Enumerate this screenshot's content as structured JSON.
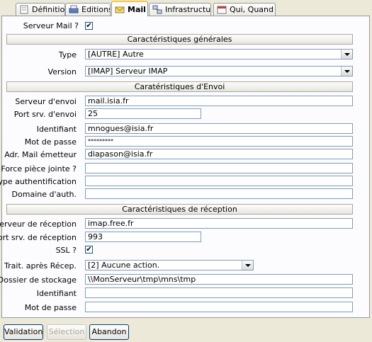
{
  "tabs": [
    {
      "label": "Définition",
      "icon": "document-icon"
    },
    {
      "label": "Editions",
      "icon": "printer-icon"
    },
    {
      "label": "Mail",
      "icon": "mail-icon",
      "active": true
    },
    {
      "label": "Infrastructure",
      "icon": "network-icon"
    },
    {
      "label": "Qui, Quand ?",
      "icon": "calendar-icon"
    }
  ],
  "serveur_mail": {
    "label": "Serveur Mail ?",
    "checked": true,
    "mark": "✔"
  },
  "general": {
    "title": "Caractéristiques générales",
    "type_label": "Type",
    "type_value": "[AUTRE] Autre",
    "version_label": "Version",
    "version_value": "[IMAP] Serveur IMAP"
  },
  "envoi": {
    "title": "Caratéristiques d'Envoi",
    "serveur_label": "Serveur d'envoi",
    "serveur_value": "mail.isia.fr",
    "port_label": "Port srv. d'envoi",
    "port_value": "25",
    "identifiant_label": "Identifiant",
    "identifiant_value": "mnogues@isia.fr",
    "password_label": "Mot de passe",
    "password_value": "*********",
    "emetteur_label": "Adr. Mail émetteur",
    "emetteur_value": "diapason@isia.fr",
    "piece_label": "Force pièce jointe ?",
    "piece_value": "",
    "auth_type_label": "Type authentification",
    "auth_type_value": "",
    "domaine_label": "Domaine d'auth.",
    "domaine_value": ""
  },
  "reception": {
    "title": "Caractéristiques de réception",
    "serveur_label": "Serveur de réception",
    "serveur_value": "imap.free.fr",
    "port_label": "Port srv. de réception",
    "port_value": "993",
    "ssl_label": "SSL ?",
    "ssl_checked": true,
    "ssl_mark": "✔",
    "trait_label": "Trait. après Récep.",
    "trait_value": "[2] Aucune action.",
    "dossier_label": "Dossier de stockage",
    "dossier_value": "\\\\MonServeur\\tmp\\mns\\tmp",
    "identifiant_label": "Identifiant",
    "identifiant_value": "",
    "password_label": "Mot de passe",
    "password_value": ""
  },
  "buttons": {
    "validation": "Validation",
    "selection": "Sélection",
    "abandon": "Abandon"
  }
}
